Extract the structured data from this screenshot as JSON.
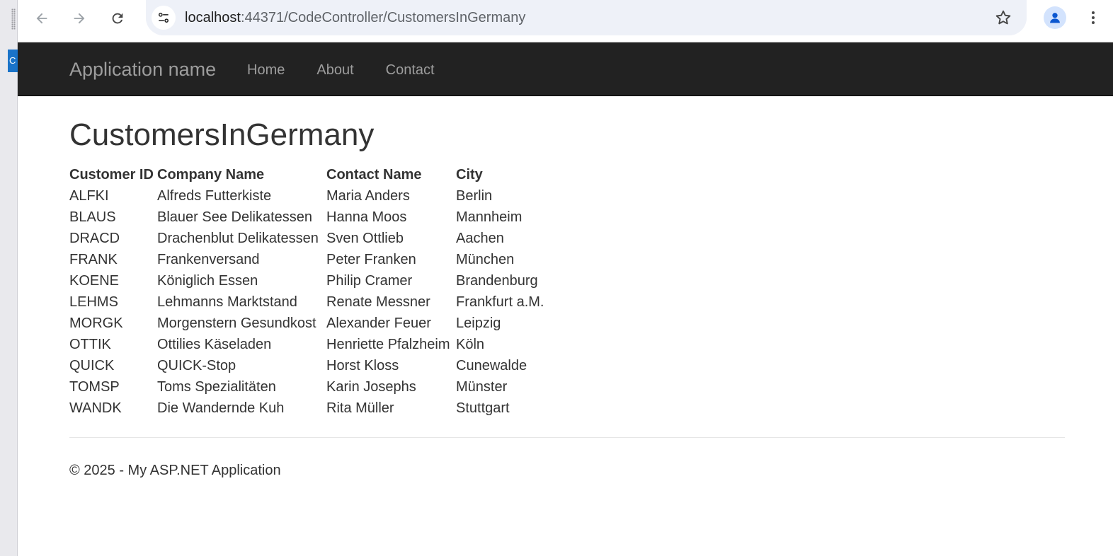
{
  "browser": {
    "url_host": "localhost",
    "url_rest": ":44371/CodeController/CustomersInGermany",
    "icons": {
      "back": "back-arrow-icon",
      "forward": "forward-arrow-icon",
      "reload": "reload-icon",
      "site_info": "tune-icon",
      "bookmark": "star-icon",
      "profile": "person-icon",
      "menu": "kebab-menu-icon"
    }
  },
  "left_window": {
    "tab_char": "C"
  },
  "navbar": {
    "brand": "Application name",
    "links": [
      "Home",
      "About",
      "Contact"
    ]
  },
  "page": {
    "title": "CustomersInGermany",
    "table": {
      "headers": [
        "Customer ID",
        "Company Name",
        "Contact Name",
        "City"
      ],
      "rows": [
        [
          "ALFKI",
          "Alfreds Futterkiste",
          "Maria Anders",
          "Berlin"
        ],
        [
          "BLAUS",
          "Blauer See Delikatessen",
          "Hanna Moos",
          "Mannheim"
        ],
        [
          "DRACD",
          "Drachenblut Delikatessen",
          "Sven Ottlieb",
          "Aachen"
        ],
        [
          "FRANK",
          "Frankenversand",
          "Peter Franken",
          "München"
        ],
        [
          "KOENE",
          "Königlich Essen",
          "Philip Cramer",
          "Brandenburg"
        ],
        [
          "LEHMS",
          "Lehmanns Marktstand",
          "Renate Messner",
          "Frankfurt a.M."
        ],
        [
          "MORGK",
          "Morgenstern Gesundkost",
          "Alexander Feuer",
          "Leipzig"
        ],
        [
          "OTTIK",
          "Ottilies Käseladen",
          "Henriette Pfalzheim",
          "Köln"
        ],
        [
          "QUICK",
          "QUICK-Stop",
          "Horst Kloss",
          "Cunewalde"
        ],
        [
          "TOMSP",
          "Toms Spezialitäten",
          "Karin Josephs",
          "Münster"
        ],
        [
          "WANDK",
          "Die Wandernde Kuh",
          "Rita Müller",
          "Stuttgart"
        ]
      ]
    }
  },
  "footer": {
    "text": "© 2025 - My ASP.NET Application"
  },
  "colors": {
    "navbar_bg": "#222222",
    "navbar_text": "#9d9d9d",
    "omnibox_bg": "#eef1f8",
    "body_text": "#333333",
    "profile_accent": "#0b57d0"
  }
}
